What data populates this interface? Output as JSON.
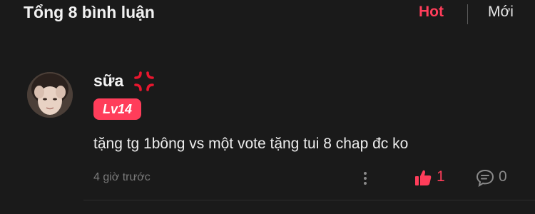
{
  "header": {
    "title": "Tổng 8 bình luận",
    "tabs": [
      {
        "label": "Hot",
        "active": true
      },
      {
        "label": "Mới",
        "active": false
      }
    ]
  },
  "comment": {
    "username": "sữa",
    "level_badge": "Lv14",
    "text": "tặng tg 1bông vs một vote tặng tui 8 chap đc ko",
    "time": "4 giờ trước",
    "likes": "1",
    "replies": "0"
  },
  "colors": {
    "accent": "#ff3d5a",
    "background": "#1a1a1a"
  }
}
